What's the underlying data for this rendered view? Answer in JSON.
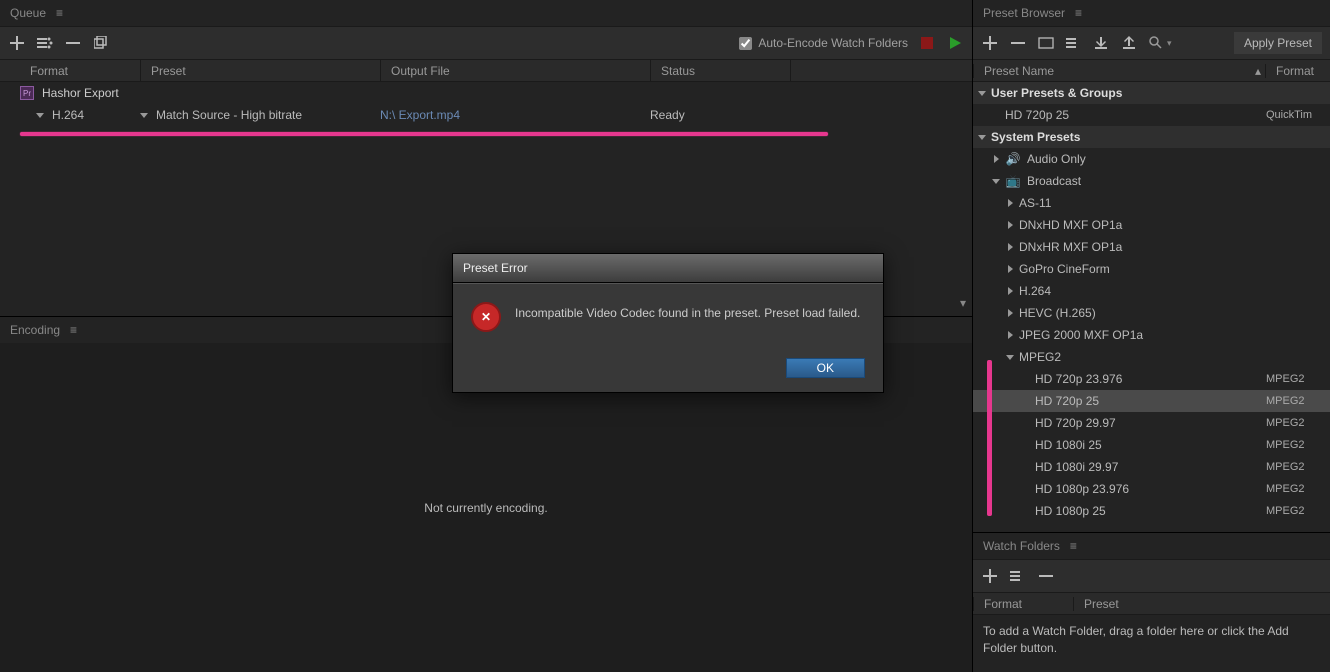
{
  "queue": {
    "title": "Queue",
    "autoEncodeLabel": "Auto-Encode Watch Folders",
    "autoEncodeChecked": true,
    "columns": {
      "format": "Format",
      "preset": "Preset",
      "output": "Output File",
      "status": "Status"
    },
    "group": {
      "title": "Hashor Export"
    },
    "item": {
      "format": "H.264",
      "preset": "Match Source - High bitrate",
      "output": "N:\\  Export.mp4",
      "status": "Ready"
    }
  },
  "encoding": {
    "title": "Encoding",
    "empty": "Not currently encoding."
  },
  "presetBrowser": {
    "title": "Preset Browser",
    "applyLabel": "Apply Preset",
    "columns": {
      "name": "Preset Name",
      "format": "Format"
    },
    "userHeader": "User Presets & Groups",
    "userPresets": [
      {
        "name": "HD 720p 25",
        "format": "QuickTim"
      }
    ],
    "systemHeader": "System Presets",
    "systemGroups": [
      {
        "name": "Audio Only",
        "icon": "speaker",
        "expanded": false
      },
      {
        "name": "Broadcast",
        "icon": "tv",
        "expanded": true,
        "children": [
          {
            "name": "AS-11",
            "expanded": false
          },
          {
            "name": "DNxHD MXF OP1a",
            "expanded": false
          },
          {
            "name": "DNxHR MXF OP1a",
            "expanded": false
          },
          {
            "name": "GoPro CineForm",
            "expanded": false
          },
          {
            "name": "H.264",
            "expanded": false
          },
          {
            "name": "HEVC (H.265)",
            "expanded": false
          },
          {
            "name": "JPEG 2000 MXF OP1a",
            "expanded": false
          },
          {
            "name": "MPEG2",
            "expanded": true,
            "children": [
              {
                "name": "HD 720p 23.976",
                "format": "MPEG2"
              },
              {
                "name": "HD 720p 25",
                "format": "MPEG2",
                "selected": true
              },
              {
                "name": "HD 720p 29.97",
                "format": "MPEG2"
              },
              {
                "name": "HD 1080i 25",
                "format": "MPEG2"
              },
              {
                "name": "HD 1080i 29.97",
                "format": "MPEG2"
              },
              {
                "name": "HD 1080p 23.976",
                "format": "MPEG2"
              },
              {
                "name": "HD 1080p 25",
                "format": "MPEG2"
              }
            ]
          }
        ]
      }
    ]
  },
  "watchFolders": {
    "title": "Watch Folders",
    "columns": {
      "format": "Format",
      "preset": "Preset"
    },
    "hint": "To add a Watch Folder, drag a folder here or click the Add Folder button."
  },
  "dialog": {
    "title": "Preset Error",
    "message": "Incompatible Video Codec found in the preset. Preset load failed.",
    "ok": "OK"
  }
}
